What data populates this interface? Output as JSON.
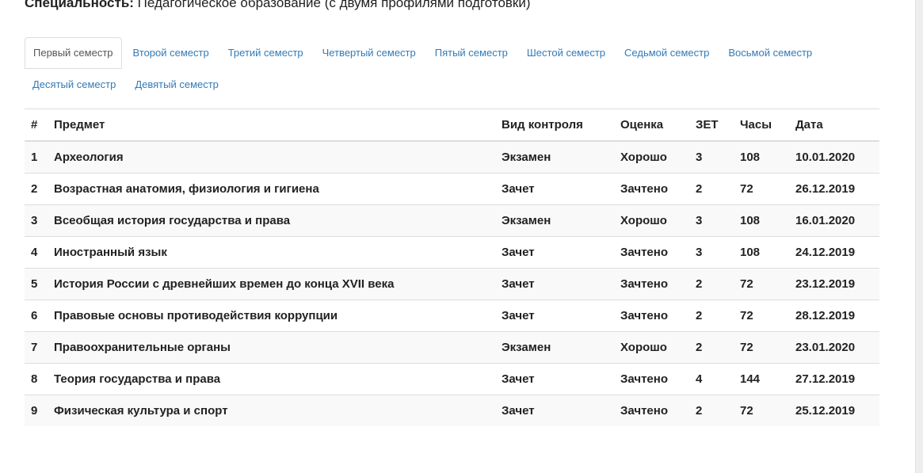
{
  "header": {
    "specialty_label": "Специальность:",
    "specialty_value": "Педагогическое образование (с двумя профилями подготовки)"
  },
  "tabs": [
    {
      "label": "Первый семестр",
      "active": true
    },
    {
      "label": "Второй семестр",
      "active": false
    },
    {
      "label": "Третий семестр",
      "active": false
    },
    {
      "label": "Четвертый семестр",
      "active": false
    },
    {
      "label": "Пятый семестр",
      "active": false
    },
    {
      "label": "Шестой семестр",
      "active": false
    },
    {
      "label": "Седьмой семестр",
      "active": false
    },
    {
      "label": "Восьмой семестр",
      "active": false
    },
    {
      "label": "Десятый семестр",
      "active": false
    },
    {
      "label": "Девятый семестр",
      "active": false
    }
  ],
  "table": {
    "columns": [
      "#",
      "Предмет",
      "Вид контроля",
      "Оценка",
      "ЗЕТ",
      "Часы",
      "Дата"
    ],
    "rows": [
      [
        "1",
        "Археология",
        "Экзамен",
        "Хорошо",
        "3",
        "108",
        "10.01.2020"
      ],
      [
        "2",
        "Возрастная анатомия, физиология и гигиена",
        "Зачет",
        "Зачтено",
        "2",
        "72",
        "26.12.2019"
      ],
      [
        "3",
        "Всеобщая история государства и права",
        "Экзамен",
        "Хорошо",
        "3",
        "108",
        "16.01.2020"
      ],
      [
        "4",
        "Иностранный язык",
        "Зачет",
        "Зачтено",
        "3",
        "108",
        "24.12.2019"
      ],
      [
        "5",
        "История России с древнейших времен до конца XVII века",
        "Зачет",
        "Зачтено",
        "2",
        "72",
        "23.12.2019"
      ],
      [
        "6",
        "Правовые основы противодействия коррупции",
        "Зачет",
        "Зачтено",
        "2",
        "72",
        "28.12.2019"
      ],
      [
        "7",
        "Правоохранительные органы",
        "Экзамен",
        "Хорошо",
        "2",
        "72",
        "23.01.2020"
      ],
      [
        "8",
        "Теория государства и права",
        "Зачет",
        "Зачтено",
        "4",
        "144",
        "27.12.2019"
      ],
      [
        "9",
        "Физическая культура и спорт",
        "Зачет",
        "Зачтено",
        "2",
        "72",
        "25.12.2019"
      ]
    ]
  }
}
